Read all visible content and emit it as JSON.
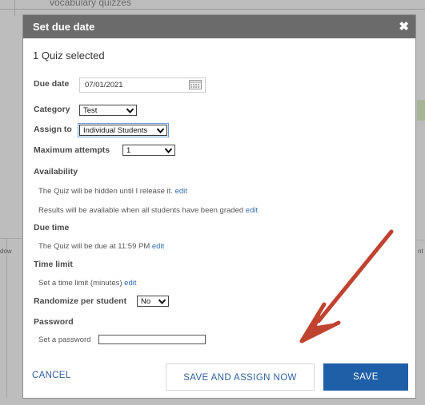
{
  "background": {
    "partial_text": "vocabulary quizzes",
    "edge_left": "dow",
    "edge_right": "nt"
  },
  "dialog": {
    "title": "Set due date",
    "close_icon": "close-icon",
    "summary": "1 Quiz selected",
    "due_date": {
      "label": "Due date",
      "value": "07/01/2021",
      "icon": "calendar-icon"
    },
    "category": {
      "label": "Category",
      "value": "Test"
    },
    "assign_to": {
      "label": "Assign to",
      "value": "Individual Students"
    },
    "max_attempts": {
      "label": "Maximum attempts",
      "value": "1"
    },
    "availability": {
      "label": "Availability",
      "line1": "The Quiz will be hidden until  I release it.",
      "line1_edit": "edit",
      "line2": "Results will be available  when all students have been graded",
      "line2_edit": "edit"
    },
    "due_time": {
      "label": "Due time",
      "text": "The Quiz will be due at",
      "time": "11:59 PM",
      "edit": "edit"
    },
    "time_limit": {
      "label": "Time limit",
      "text": "Set a time limit (minutes)",
      "edit": "edit"
    },
    "randomize": {
      "label": "Randomize per student",
      "value": "No"
    },
    "password": {
      "label": "Password",
      "text": "Set a password",
      "value": ""
    },
    "footer": {
      "cancel": "CANCEL",
      "save_assign": "SAVE AND ASSIGN NOW",
      "save": "SAVE"
    }
  },
  "colors": {
    "header_bg": "#6b6b6b",
    "primary_button": "#1f5fa8",
    "link": "#2f6db5",
    "annotation_arrow": "#c0432f"
  }
}
